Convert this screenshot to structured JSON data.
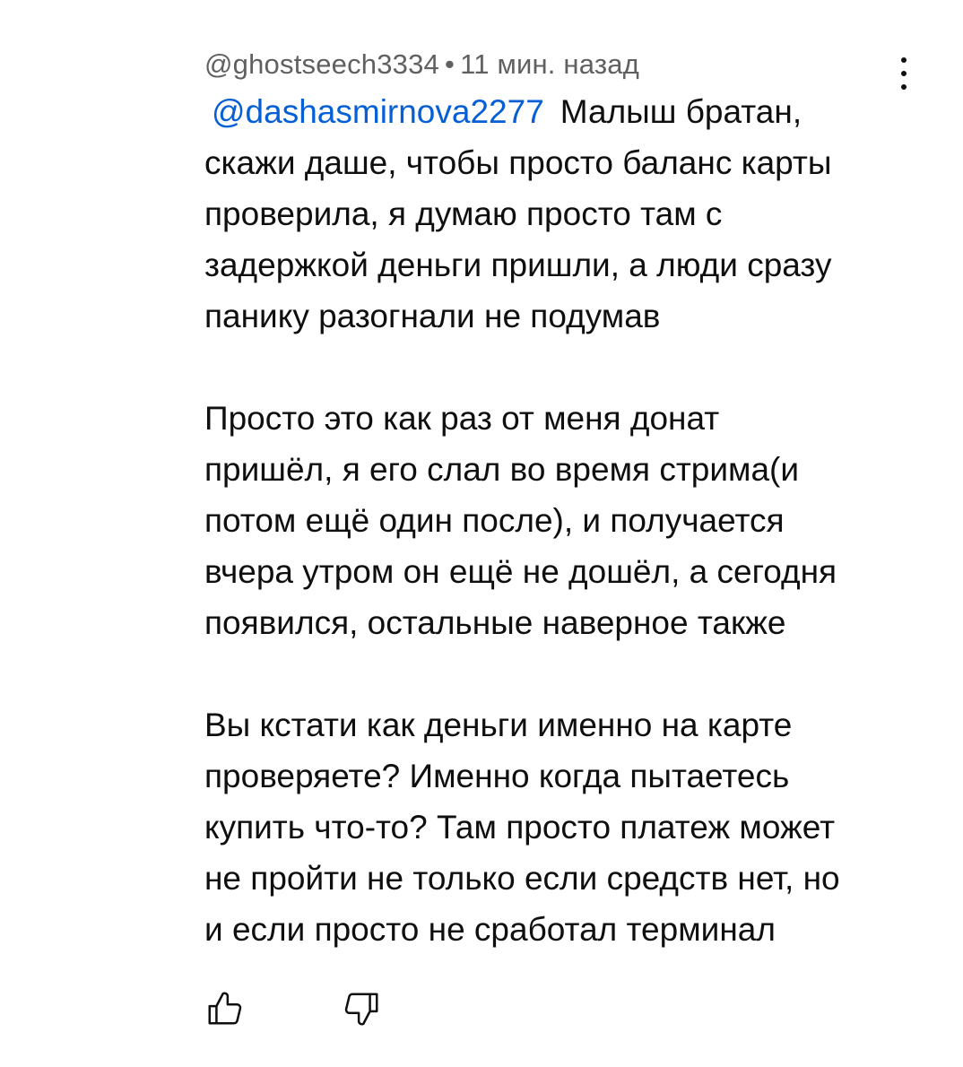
{
  "comment": {
    "author": "@ghostseech3334",
    "separator": "•",
    "time": "11 мин. назад",
    "mention": "@dashasmirnova2277",
    "paragraph1": "Малыш братан,\nскажи даше, чтобы просто баланс карты\nпроверила, я думаю просто там с\nзадержкой деньги пришли, а люди сразу\nпанику разогнали не подумав",
    "paragraph2": "Просто это как раз от меня донат\nпришёл, я его слал во время стрима(и\nпотом ещё один после), и получается\nвчера утром он ещё не дошёл, а сегодня\nпоявился, остальные наверное также",
    "paragraph3": "Вы кстати как деньги именно на карте\nпроверяете? Именно когда пытаетесь\nкупить что-то? Там просто платеж может\nне пройти не только если средств нет, но\nи если просто не сработал терминал"
  },
  "icons": {
    "menu": "more-vertical-icon",
    "like": "thumbs-up-icon",
    "dislike": "thumbs-down-icon"
  },
  "colors": {
    "text": "#0f0f0f",
    "meta": "#606060",
    "mention": "#065fd4",
    "background": "#ffffff"
  }
}
